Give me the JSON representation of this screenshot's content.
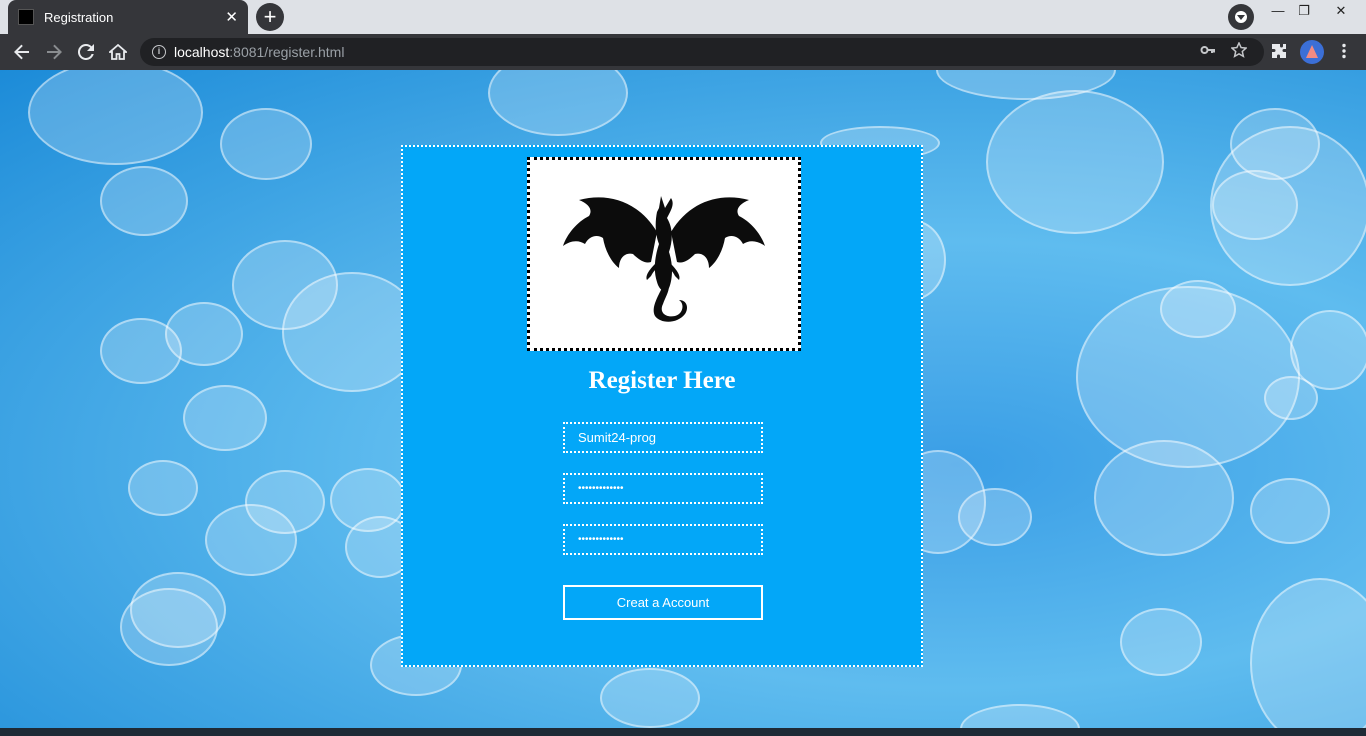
{
  "browser": {
    "tab_title": "Registration",
    "tab_close": "✕",
    "new_tab": "+",
    "url_host": "localhost",
    "url_rest": ":8081/register.html",
    "window_controls": {
      "minimize": "—",
      "restore": "❐",
      "close": "✕"
    }
  },
  "form": {
    "heading": "Register Here",
    "username_value": "Sumit24-prog",
    "password_value": "•••••••••••••",
    "confirm_value": "•••••••••••••",
    "submit_label": "Creat a Account"
  },
  "colors": {
    "card_bg": "#03a7f8",
    "page_bg": "#1c8bd8",
    "chrome_dark": "#35363a"
  },
  "icons": {
    "back": "back-arrow-icon",
    "forward": "forward-arrow-icon",
    "reload": "reload-icon",
    "home": "home-icon",
    "key": "key-icon",
    "star": "star-icon",
    "extensions": "puzzle-icon",
    "menu": "kebab-menu-icon",
    "logo": "dragon-logo-icon"
  }
}
